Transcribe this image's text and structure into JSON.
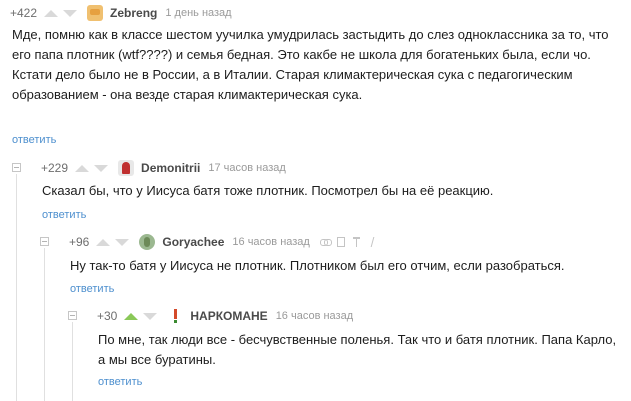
{
  "comments": [
    {
      "rating": "+422",
      "author": "Zebreng",
      "time": "1 день назад",
      "text": [
        "Мде, помню как в классе шестом уучилка умудрилась застыдить до слез одноклассника за то, что его папа плотник (wtf????) и семья бедная. Это какбе не школа для богатеньких была, если чо.",
        "Кстати дело было не в России, а в Италии. Старая климактерическая сука с педагогическим образованием - она везде старая климактерическая сука."
      ],
      "reply": "ответить"
    },
    {
      "rating": "+229",
      "author": "Demonitrii",
      "time": "17 часов назад",
      "text": [
        "Сказал бы, что у Иисуса батя тоже плотник. Посмотрел бы на её реакцию."
      ],
      "reply": "ответить"
    },
    {
      "rating": "+96",
      "author": "Goryachee",
      "time": "16 часов назад",
      "text": [
        "Ну так-то батя у Иисуса не плотник. Плотником был его отчим, если разобраться."
      ],
      "reply": "ответить"
    },
    {
      "rating": "+30",
      "author": "НАРКОМАНЕ",
      "time": "16 часов назад",
      "text": [
        "По мне, так люди все - бесчувственные поленья. Так что и батя плотник. Папа Карло, а мы все буратины."
      ],
      "reply": "ответить"
    }
  ],
  "colors": {
    "upvote_active": "#8ac858",
    "reply_link": "#4d8fce",
    "vote_inactive": "#d9d9d9"
  },
  "icons": [
    "arrow-up-icon",
    "arrow-down-icon",
    "collapse-icon",
    "link-icon",
    "save-icon",
    "report-icon",
    "more-icon"
  ]
}
